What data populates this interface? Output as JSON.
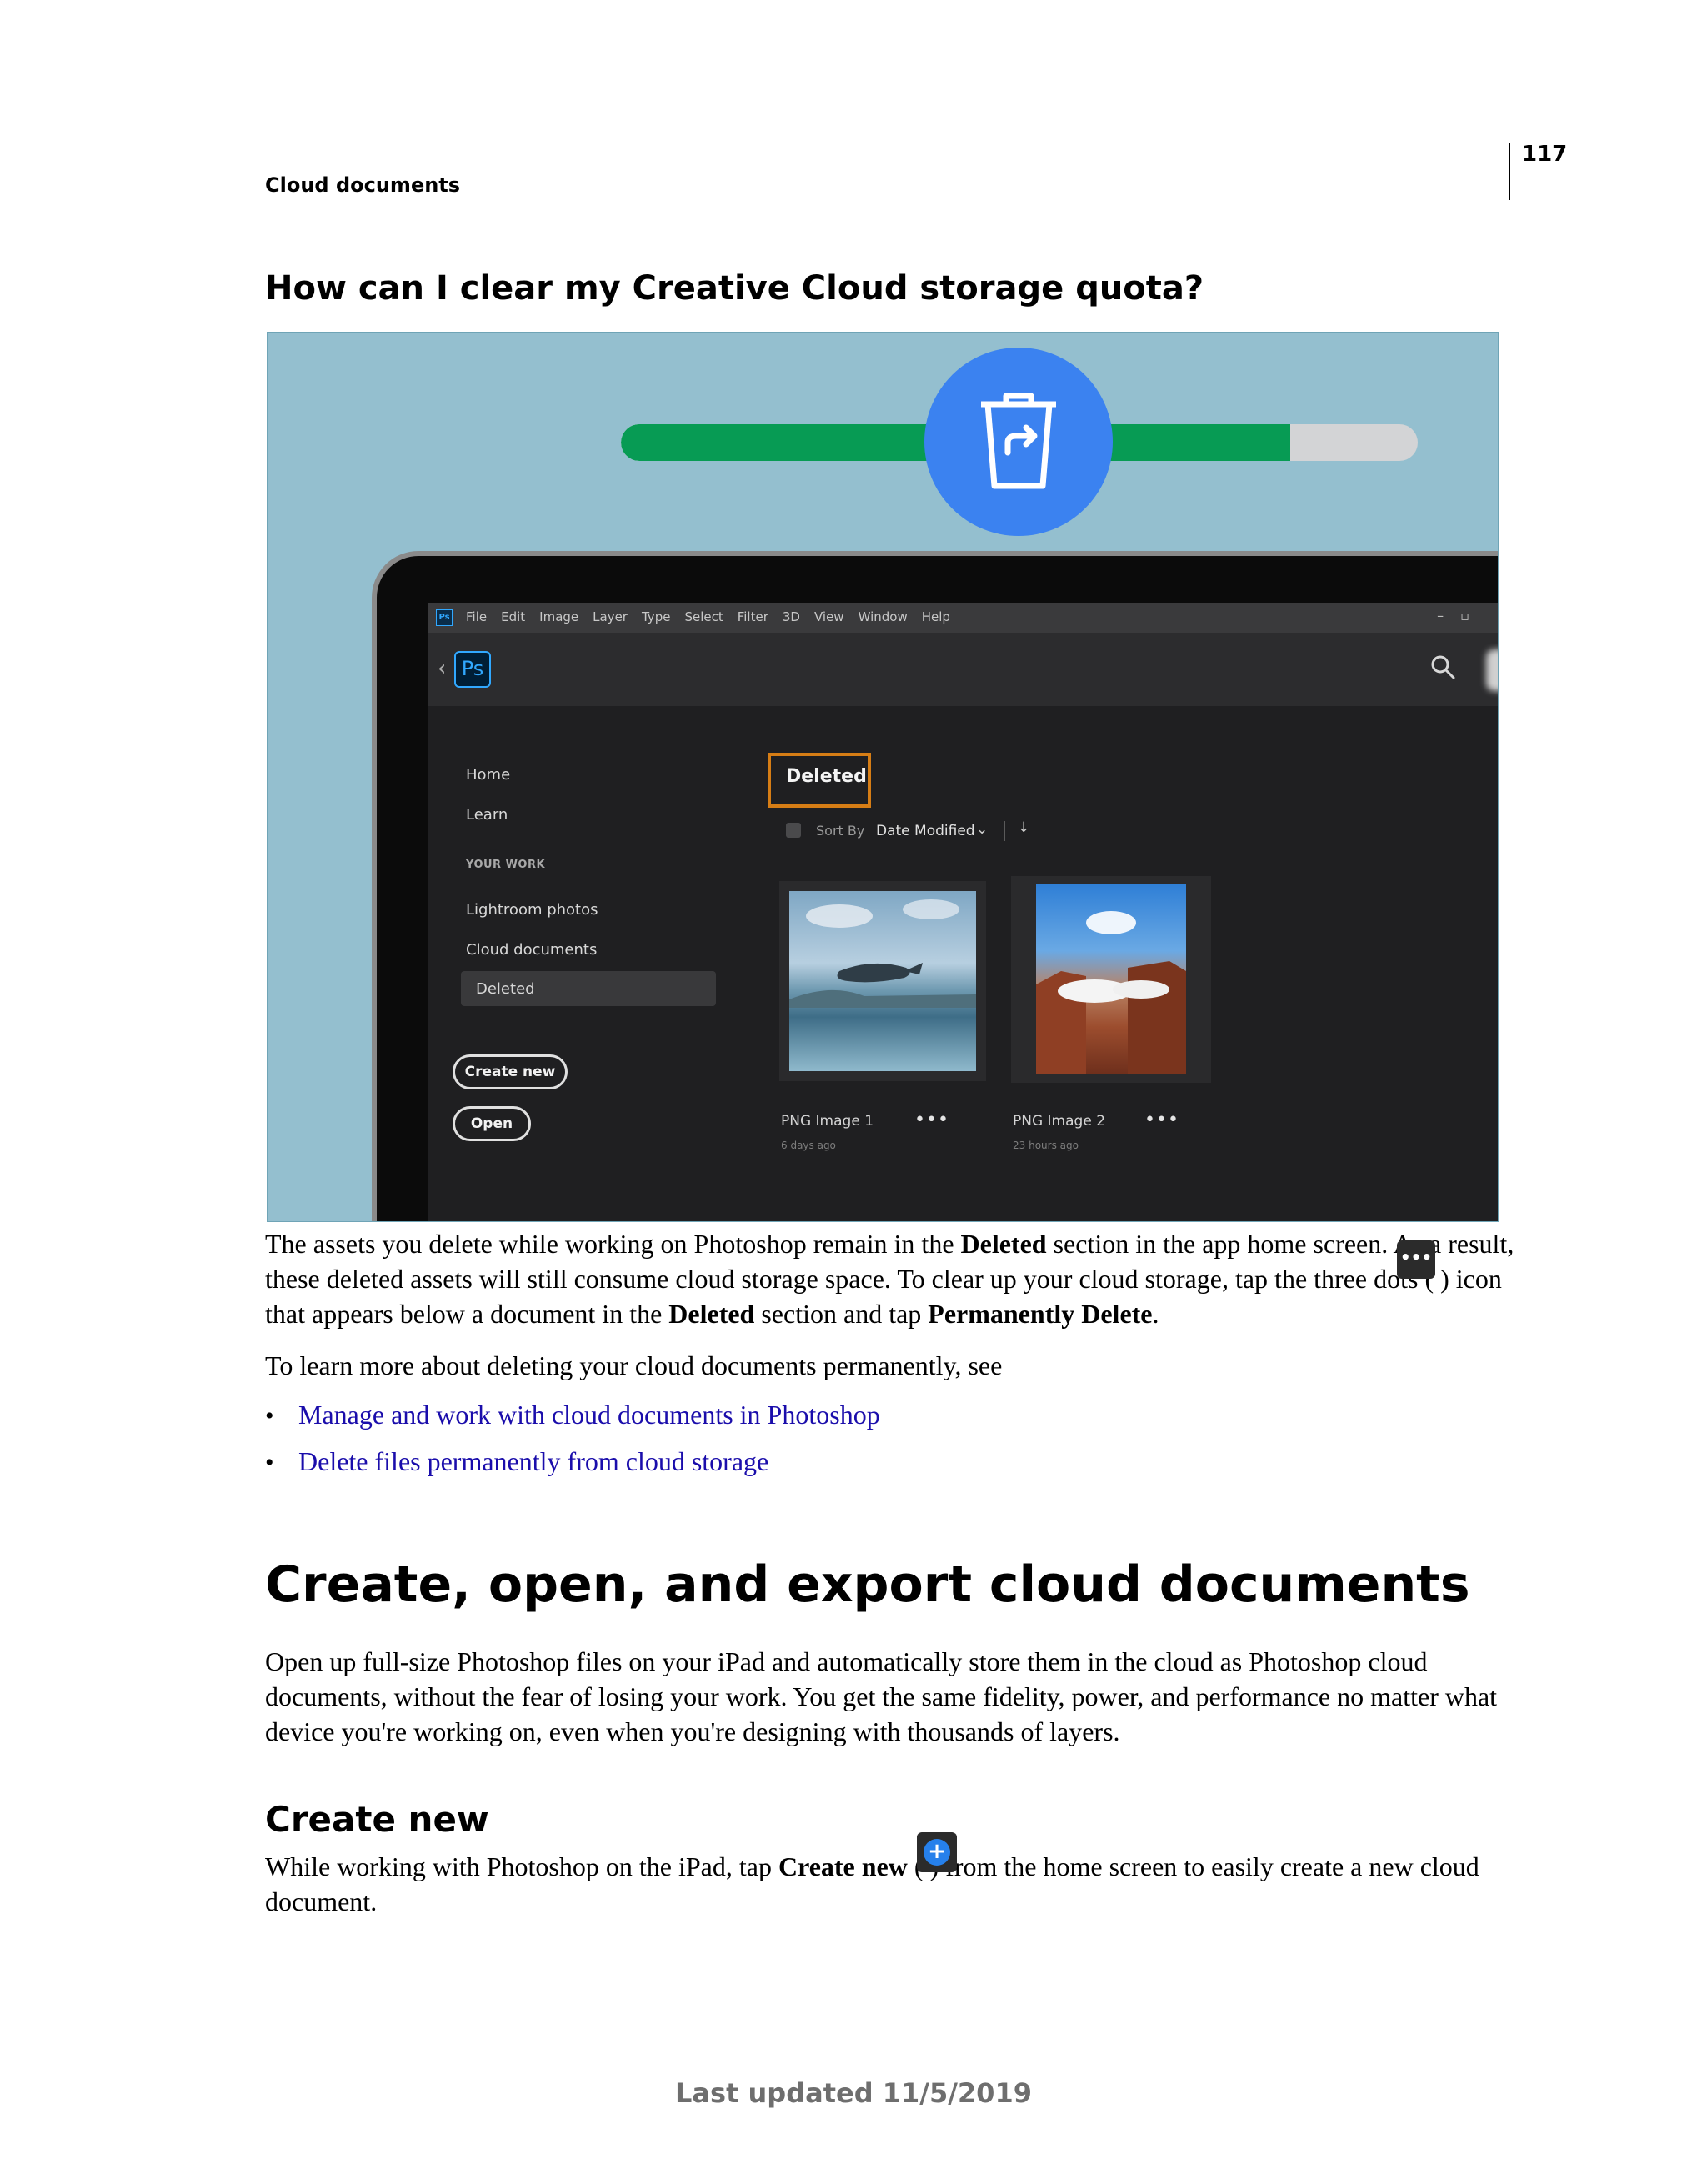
{
  "header": {
    "page_number": "117",
    "section": "Cloud documents"
  },
  "faq": {
    "heading": "How can I clear my Creative Cloud storage quota?"
  },
  "illustration": {
    "quota_fill_fraction": 0.84,
    "colors": {
      "quota_fill": "#079b54",
      "quota_track": "#d3d4d6",
      "trash_circle": "#3b82f0",
      "background": "#94bfcf"
    },
    "menu": [
      "File",
      "Edit",
      "Image",
      "Layer",
      "Type",
      "Select",
      "Filter",
      "3D",
      "View",
      "Window",
      "Help"
    ],
    "window_controls": [
      "–",
      "▫"
    ],
    "app_logo": "Ps",
    "menu_logo": "Ps",
    "back_icon": "‹",
    "nav": {
      "home": "Home",
      "learn": "Learn",
      "group": "YOUR WORK",
      "lightroom": "Lightroom photos",
      "cloud_docs": "Cloud documents",
      "deleted": "Deleted"
    },
    "buttons": {
      "create_new": "Create new",
      "open": "Open"
    },
    "content": {
      "title": "Deleted",
      "sort_label": "Sort By",
      "sort_value": "Date Modified",
      "sort_chevron": "⌄",
      "sort_direction": "↓"
    },
    "cards": [
      {
        "name": "PNG Image 1",
        "time": "6 days ago",
        "menu": "•••"
      },
      {
        "name": "PNG Image 2",
        "time": "23 hours ago",
        "menu": "•••"
      }
    ],
    "highlight_color": "#d67d15"
  },
  "body": {
    "para1_line1": "The assets you delete while working on Photoshop remain in the Deleted section in the app home screen. As a result,",
    "para1_line2": "these deleted assets will still consume cloud storage space. To clear up your cloud storage, tap the three dots (     ) icon",
    "para1_line3": "that appears below a document in the Deleted section and tap Permanently Delete.",
    "dots_icon": "•••",
    "para2": "To learn more about deleting your cloud documents permanently, see",
    "bullet": "•",
    "links": [
      "Manage and work with cloud documents in Photoshop",
      "Delete files permanently from cloud storage"
    ],
    "link_color": "#1a0dab"
  },
  "section": {
    "heading": "Create, open, and export cloud documents",
    "intro_line1": "Open up full-size Photoshop files on your iPad and automatically store them in the cloud as Photoshop cloud",
    "intro_line2": "documents, without the fear of losing your work. You get the same fidelity, power, and performance no matter what",
    "intro_line3": "device you're working on, even when you're designing with thousands of layers.",
    "subheading": "Create new",
    "create_line1_pre": "While working with Photoshop on the iPad, tap ",
    "create_line1_bold": "Create new",
    "create_line1_post": " (     ) from the home screen to easily create a new cloud",
    "create_line2": "document.",
    "create_icon": "+"
  },
  "footer": {
    "text": "Last updated 11/5/2019"
  }
}
